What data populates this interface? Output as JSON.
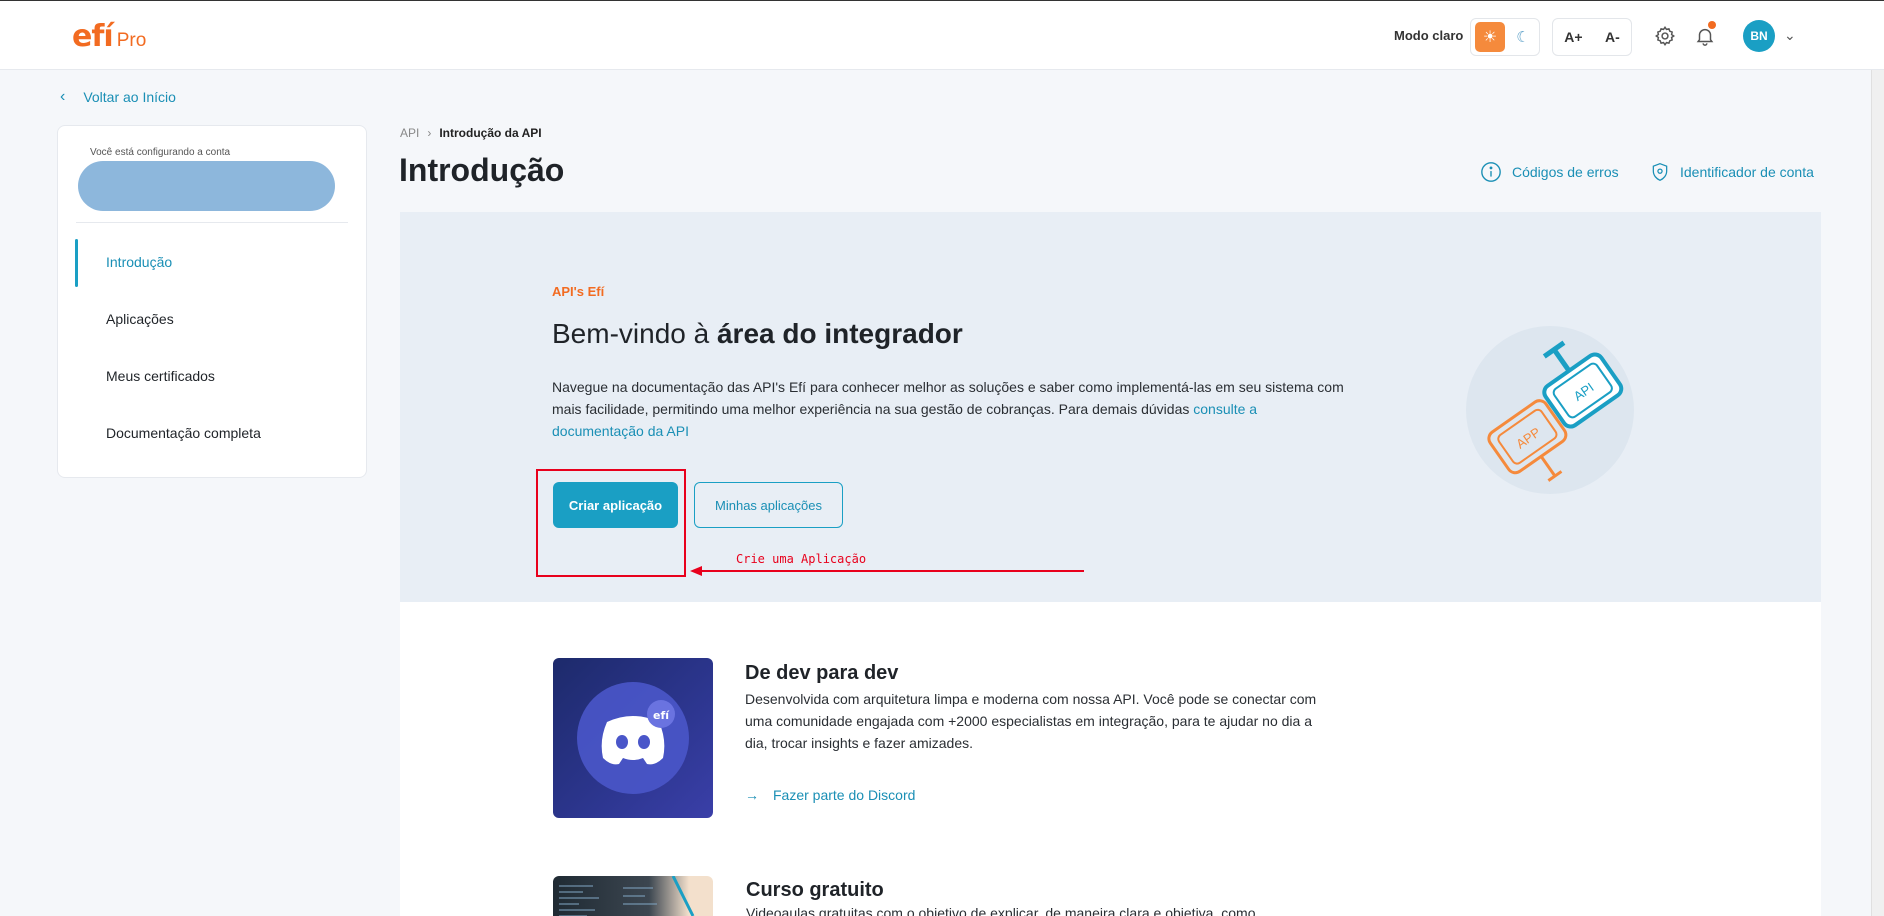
{
  "header": {
    "logo_main": "efí",
    "logo_sub": "Pro",
    "mode_label": "Modo claro",
    "font_increase": "A+",
    "font_decrease": "A-",
    "avatar_initials": "BN"
  },
  "back_link": "Voltar ao Início",
  "sidebar": {
    "account_label": "Você está configurando a conta",
    "items": [
      {
        "label": "Introdução",
        "active": true
      },
      {
        "label": "Aplicações"
      },
      {
        "label": "Meus certificados"
      },
      {
        "label": "Documentação completa"
      }
    ]
  },
  "breadcrumb": {
    "root": "API",
    "current": "Introdução da API"
  },
  "page_title": "Introdução",
  "header_links": {
    "errors": "Códigos de erros",
    "account_id": "Identificador de conta"
  },
  "hero": {
    "eyebrow": "API's Efí",
    "title_prefix": "Bem-vindo à ",
    "title_bold": "área do integrador",
    "description": "Navegue na documentação das API's Efí para conhecer melhor as soluções e saber como implementá-las em seu sistema com mais facilidade, permitindo uma melhor experiência na sua gestão de cobranças. Para demais dúvidas ",
    "description_link": "consulte a documentação da API",
    "btn_create": "Criar aplicação",
    "btn_mine": "Minhas aplicações",
    "annotation": "Crie uma Aplicação",
    "illustration_app": "APP",
    "illustration_api": "API"
  },
  "cards": [
    {
      "title": "De dev para dev",
      "description": "Desenvolvida com arquitetura limpa e moderna com nossa API. Você pode se conectar com uma comunidade engajada com +2000 especialistas em integração, para te ajudar no dia a dia, trocar insights e fazer amizades.",
      "link": "Fazer parte do Discord",
      "badge": "efí"
    },
    {
      "title": "Curso gratuito",
      "description": "Videoaulas gratuitas com o objetivo de explicar, de maneira clara e objetiva, como"
    }
  ],
  "colors": {
    "brand_orange": "#f26b21",
    "accent_blue": "#1a9fc4",
    "annotation_red": "#e8001c"
  },
  "icons": [
    "sun-icon",
    "moon-icon",
    "gear-icon",
    "bell-icon",
    "chevron-down-icon",
    "chevron-left-icon",
    "info-icon",
    "shield-icon",
    "arrow-right-icon",
    "discord-icon"
  ]
}
